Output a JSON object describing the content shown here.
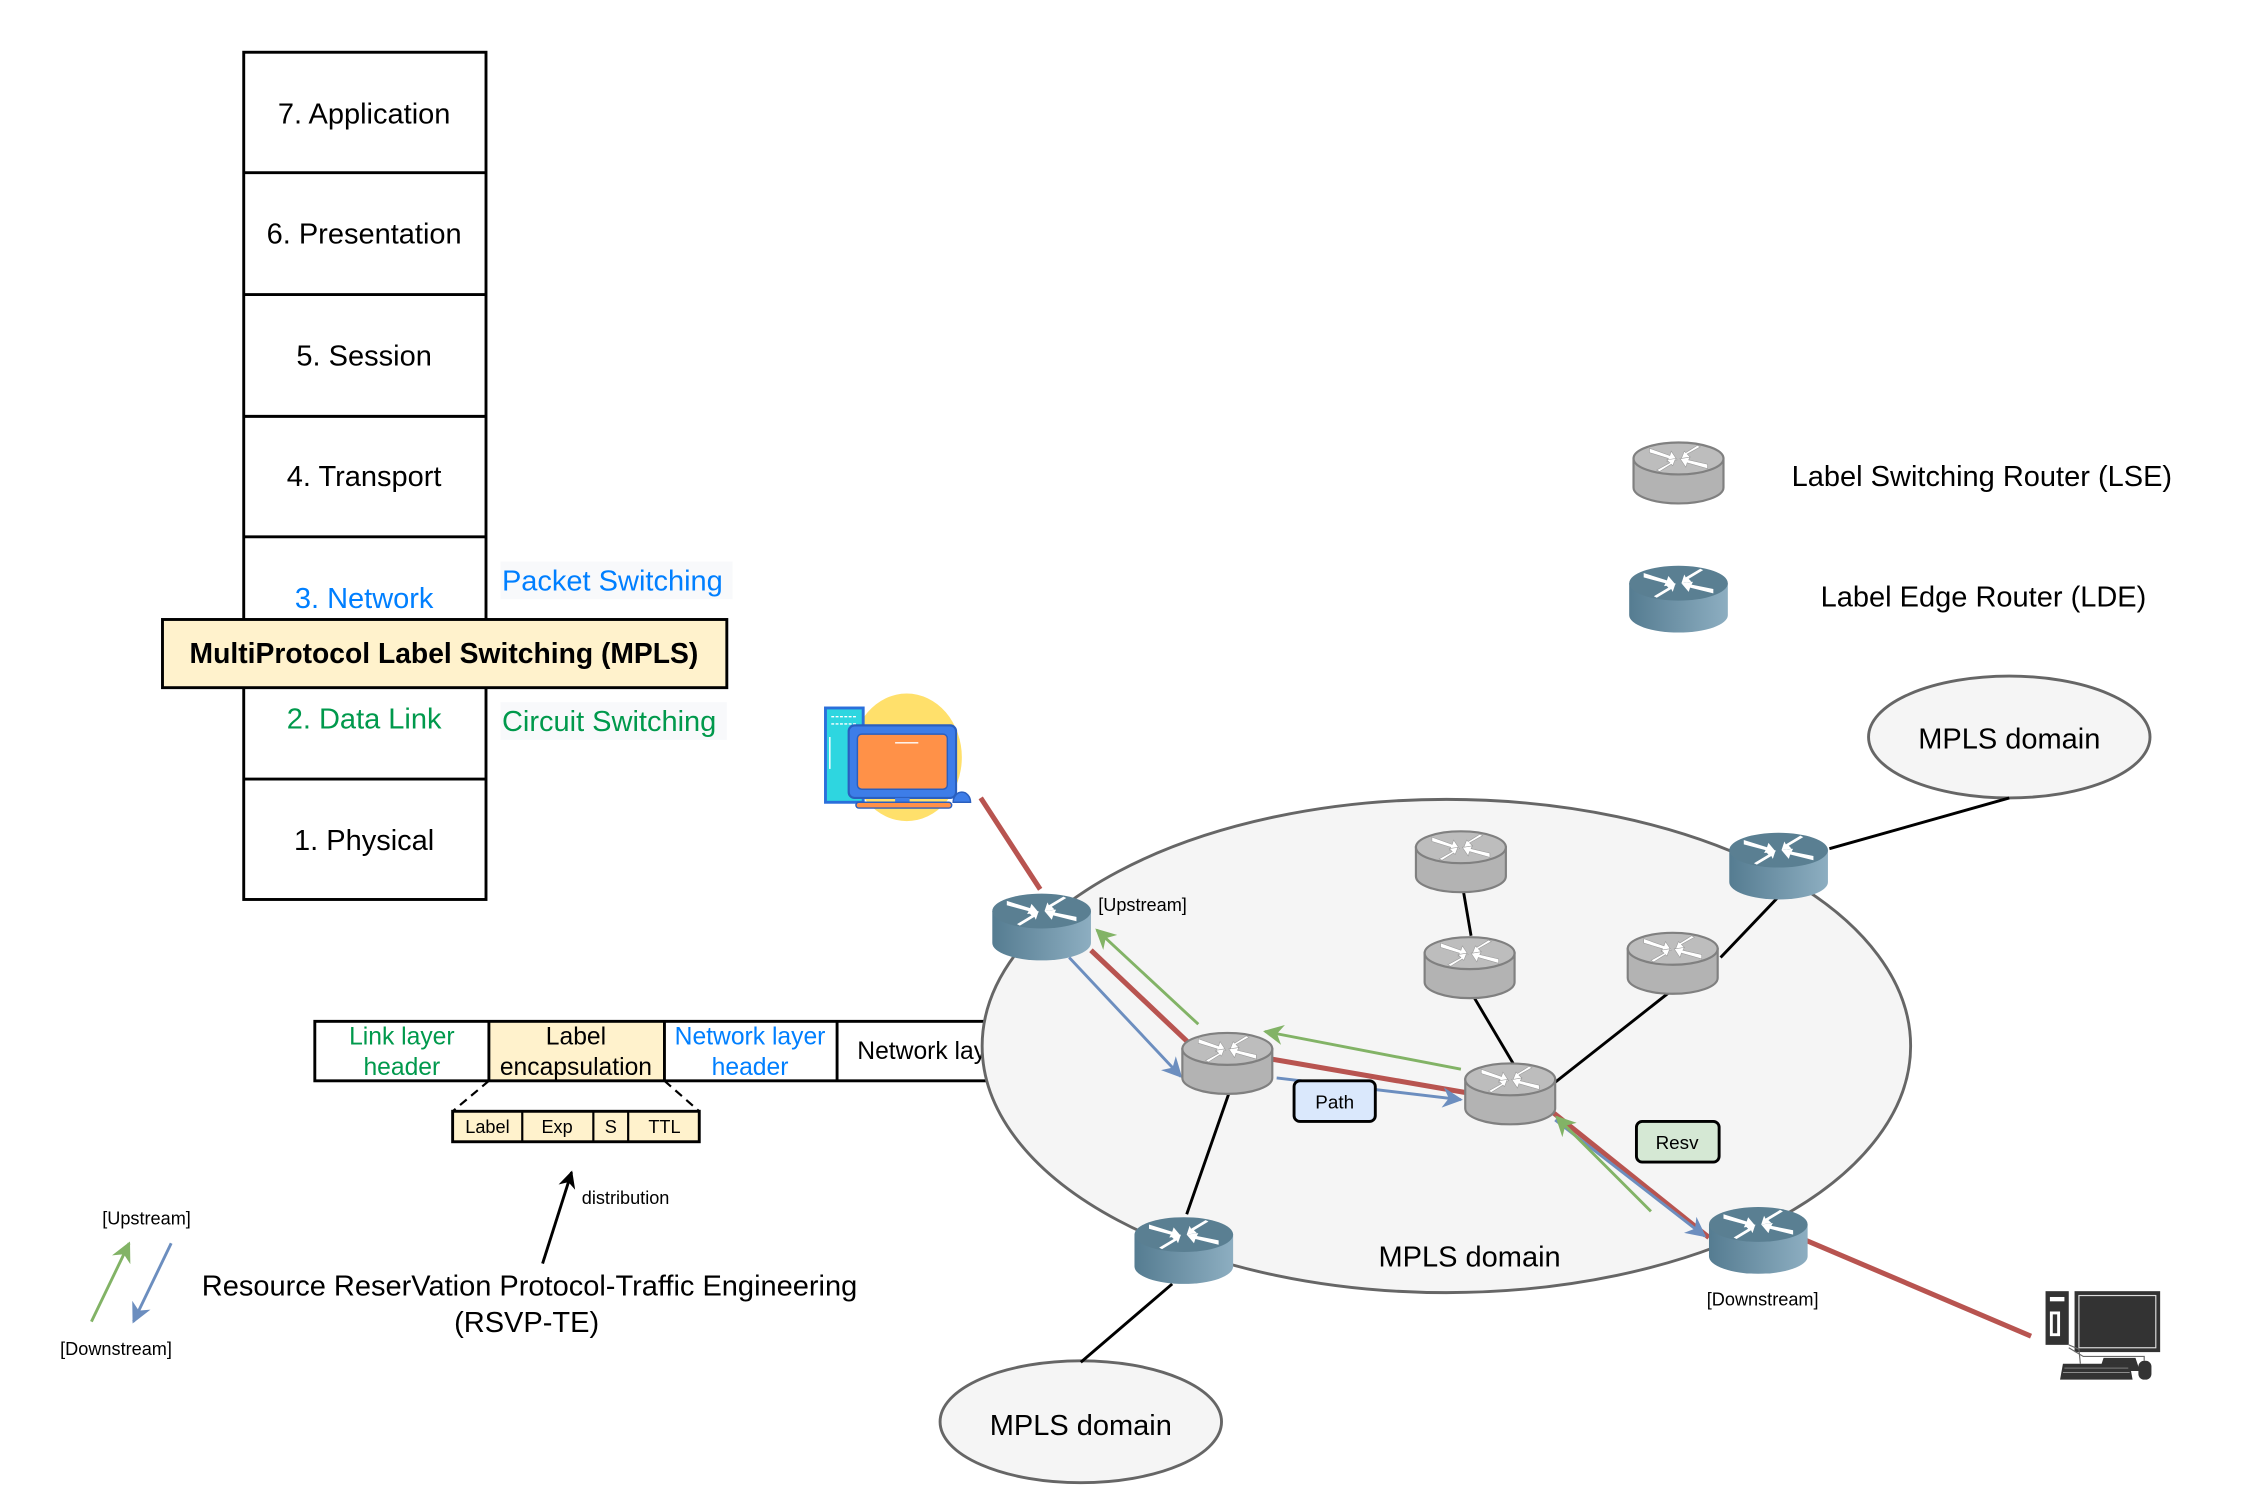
{
  "osi_stack": {
    "layers": [
      {
        "label": "7. Application",
        "color": "#000000"
      },
      {
        "label": "6. Presentation",
        "color": "#000000"
      },
      {
        "label": "5. Session",
        "color": "#000000"
      },
      {
        "label": "4. Transport",
        "color": "#000000"
      },
      {
        "label": "3. Network",
        "color": "#007FFF"
      },
      {
        "label": "2. Data Link",
        "color": "#00994C"
      },
      {
        "label": "1. Physical",
        "color": "#000000"
      }
    ],
    "mpls_label": "MultiProtocol Label Switching (MPLS)",
    "mpls_fill": "#FFF2CC",
    "packet_switching": "Packet Switching",
    "circuit_switching": "Circuit Switching"
  },
  "packet": {
    "segments": [
      {
        "line1": "Link layer",
        "line2": "header",
        "color": "#00994C"
      },
      {
        "line1": "Label",
        "line2": "encapsulation",
        "color": "#000000"
      },
      {
        "line1": "Network layer",
        "line2": "header",
        "color": "#007FFF"
      },
      {
        "line1": "Network layer payload",
        "line2": "",
        "color": "#000000"
      }
    ],
    "label_fields": [
      "Label",
      "Exp",
      "S",
      "TTL"
    ],
    "distribution_label": "distribution"
  },
  "rsvp": {
    "title_line1": "Resource ReserVation Protocol-Traffic Engineering",
    "title_line2": "(RSVP-TE)",
    "upstream_label": "[Upstream]",
    "downstream_label": "[Downstream]",
    "upstream_color": "#82B366",
    "downstream_color": "#6C8EBF"
  },
  "legend": {
    "lsr_label": "Label Switching Router (LSE)",
    "ler_label": "Label Edge Router (LDE)"
  },
  "network": {
    "main_domain_label": "MPLS domain",
    "top_right_domain_label": "MPLS domain",
    "bottom_domain_label": "MPLS domain",
    "upstream_router_label": "[Upstream]",
    "downstream_router_label": "[Downstream]",
    "path_message": "Path",
    "resv_message": "Resv",
    "lsp_color": "#B85450",
    "path_color": "#6C8EBF",
    "resv_color": "#82B366"
  }
}
